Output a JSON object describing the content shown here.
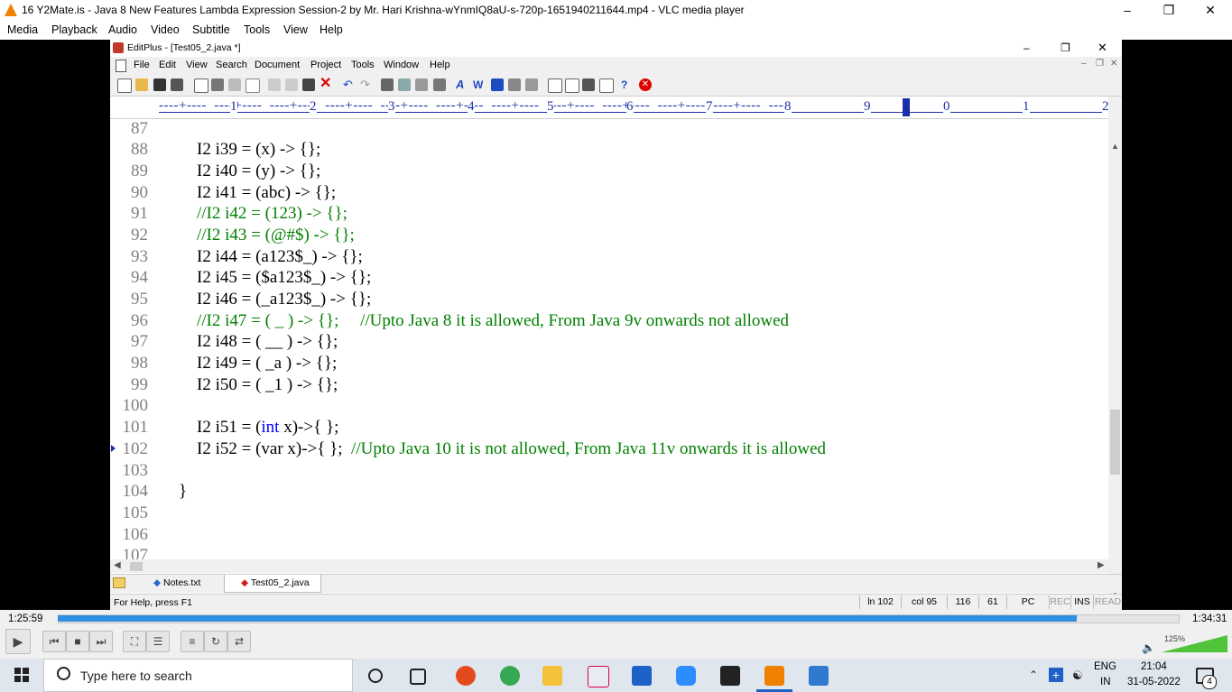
{
  "vlc": {
    "title": "16 Y2Mate.is - Java 8 New Features  Lambda Expression  Session-2  by Mr. Hari Krishna-wYnmIQ8aU-s-720p-1651940211644.mp4 - VLC media player",
    "menu": [
      "Media",
      "Playback",
      "Audio",
      "Video",
      "Subtitle",
      "Tools",
      "View",
      "Help"
    ],
    "time_elapsed": "1:25:59",
    "time_total": "1:34:31",
    "progress": 0.91,
    "volume": "125%"
  },
  "editplus": {
    "title": "EditPlus - [Test05_2.java *]",
    "menu": [
      "File",
      "Edit",
      "View",
      "Search",
      "Document",
      "Project",
      "Tools",
      "Window",
      "Help"
    ],
    "ruler": [
      "1",
      "2",
      "3",
      "4",
      "5",
      "6",
      "7",
      "8",
      "9",
      "0",
      "1",
      "2"
    ],
    "lines": [
      {
        "n": "87",
        "code": "",
        "comment": ""
      },
      {
        "n": "88",
        "code": "I2 i39 = (x) -> {};",
        "comment": ""
      },
      {
        "n": "89",
        "code": "I2 i40 = (y) -> {};",
        "comment": ""
      },
      {
        "n": "90",
        "code": "I2 i41 = (abc) -> {};",
        "comment": ""
      },
      {
        "n": "91",
        "code": "",
        "comment": "//I2 i42 = (123) -> {};"
      },
      {
        "n": "92",
        "code": "",
        "comment": "//I2 i43 = (@#$) -> {};"
      },
      {
        "n": "93",
        "code": "I2 i44 = (a123$_) -> {};",
        "comment": ""
      },
      {
        "n": "94",
        "code": "I2 i45 = ($a123$_) -> {};",
        "comment": ""
      },
      {
        "n": "95",
        "code": "I2 i46 = (_a123$_) -> {};",
        "comment": ""
      },
      {
        "n": "96",
        "code": "",
        "comment": "//I2 i47 = ( _ ) -> {};     //Upto Java 8 it is allowed, From Java 9v onwards not allowed"
      },
      {
        "n": "97",
        "code": "I2 i48 = ( __ ) -> {};",
        "comment": ""
      },
      {
        "n": "98",
        "code": "I2 i49 = ( _a ) -> {};",
        "comment": ""
      },
      {
        "n": "99",
        "code": "I2 i50 = ( _1 ) -> {};",
        "comment": ""
      },
      {
        "n": "100",
        "code": "",
        "comment": ""
      },
      {
        "n": "101",
        "code_pre": "I2 i51 = (",
        "keyword": "int",
        "code_post": " x)->{ };",
        "comment": ""
      },
      {
        "n": "102",
        "code": "I2 i52 = (var x)->{ };  ",
        "comment": "//Upto Java 10 it is not allowed, From Java 11v onwards it is allowed"
      },
      {
        "n": "103",
        "code": "",
        "comment": ""
      },
      {
        "n": "104",
        "code": "}",
        "comment": ""
      },
      {
        "n": "105",
        "code": "",
        "comment": ""
      },
      {
        "n": "106",
        "code": "",
        "comment": ""
      },
      {
        "n": "107",
        "code": "",
        "comment": ""
      }
    ],
    "tabs": [
      "Notes.txt",
      "Test05_2.java"
    ],
    "status": {
      "help": "For Help, press F1",
      "ln": "ln 102",
      "col": "col 95",
      "c1": "116",
      "c2": "61",
      "mode": "PC",
      "rec": "REC",
      "ins": "INS",
      "read": "READ"
    }
  },
  "taskbar": {
    "search_placeholder": "Type here to search",
    "lang1": "ENG",
    "lang2": "IN",
    "time": "21:04",
    "date": "31-05-2022",
    "notifications": "4"
  }
}
